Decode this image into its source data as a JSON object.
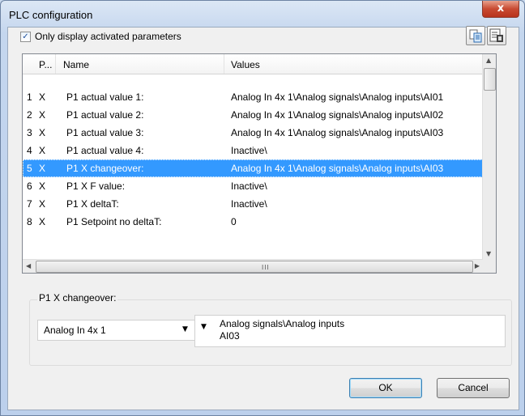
{
  "window": {
    "title": "PLC configuration",
    "close_glyph": "x"
  },
  "filter": {
    "checked": true,
    "check_glyph": "✓",
    "label": "Only display activated parameters"
  },
  "toolbar": {
    "icons": [
      "copy-icon",
      "properties-icon"
    ]
  },
  "table": {
    "headers": [
      "",
      "P...",
      "Name",
      "Values"
    ],
    "rows": [
      {
        "num": "1",
        "p": "X",
        "name": "P1 actual value 1:",
        "value": "Analog In 4x 1\\Analog signals\\Analog inputs\\AI01"
      },
      {
        "num": "2",
        "p": "X",
        "name": "P1 actual value 2:",
        "value": "Analog In 4x 1\\Analog signals\\Analog inputs\\AI02"
      },
      {
        "num": "3",
        "p": "X",
        "name": "P1 actual value 3:",
        "value": "Analog In 4x 1\\Analog signals\\Analog inputs\\AI03"
      },
      {
        "num": "4",
        "p": "X",
        "name": "P1 actual value 4:",
        "value": "Inactive\\"
      },
      {
        "num": "5",
        "p": "X",
        "name": "P1 X changeover:",
        "value": "Analog In 4x 1\\Analog signals\\Analog inputs\\AI03"
      },
      {
        "num": "6",
        "p": "X",
        "name": "P1 X F value:",
        "value": "Inactive\\"
      },
      {
        "num": "7",
        "p": "X",
        "name": "P1 X deltaT:",
        "value": "Inactive\\"
      },
      {
        "num": "8",
        "p": "X",
        "name": "P1 Setpoint no deltaT:",
        "value": "0"
      }
    ],
    "selected_row": "5",
    "scroll_glyphs": {
      "up": "▲",
      "down": "▼",
      "left": "◀",
      "right": "▶",
      "grip": "III"
    }
  },
  "detail": {
    "group_label": "P1 X changeover:",
    "module_value": "Analog In 4x 1",
    "dropdown_glyph": "▼",
    "path_lines": [
      "Analog signals\\Analog inputs",
      "AI03"
    ]
  },
  "buttons": {
    "ok": "OK",
    "cancel": "Cancel"
  },
  "colors": {
    "selection": "#3399ff",
    "close_button": "#c84a32"
  }
}
